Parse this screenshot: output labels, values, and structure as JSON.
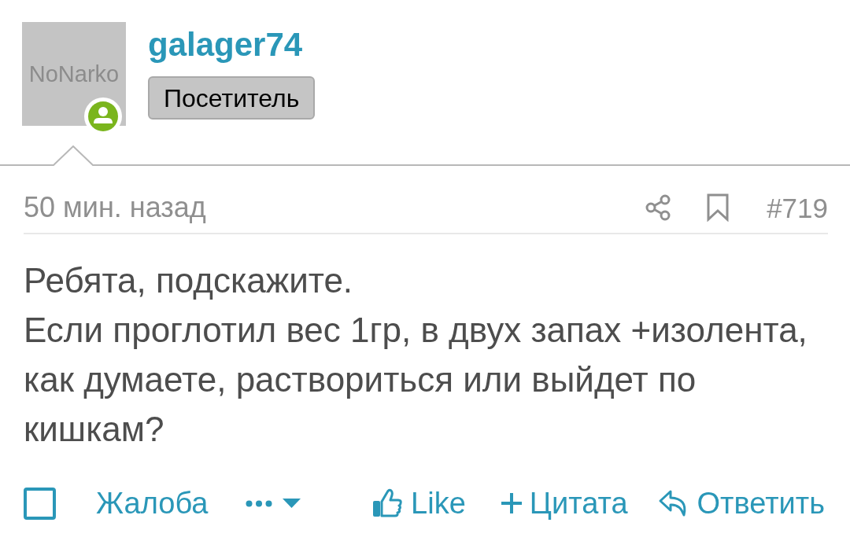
{
  "author": {
    "avatar_text": "NoNarko",
    "online": true,
    "username": "galager74",
    "user_title": "Посетитель"
  },
  "post": {
    "time": "50 мин. назад",
    "number": "#719",
    "paragraphs": [
      "Ребята, подскажите.",
      "Если проглотил вес 1гр, в двух запах +изолента, как думаете, раствориться или выйдет по кишкам?"
    ]
  },
  "actions": {
    "select": {
      "checked": false
    },
    "report": "Жалоба",
    "like": "Like",
    "quote": "Цитата",
    "reply": "Ответить"
  }
}
